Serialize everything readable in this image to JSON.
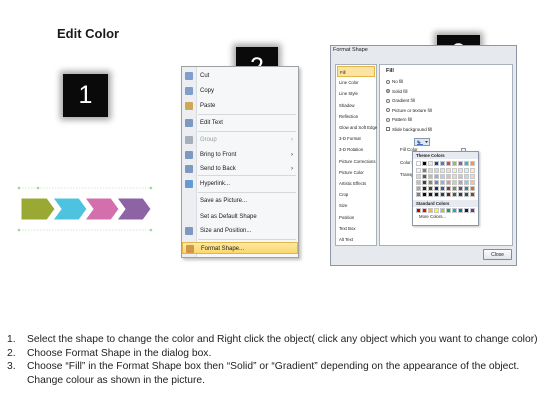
{
  "title": "Edit Color",
  "badges": [
    "1",
    "2",
    "3"
  ],
  "colors": {
    "arrow_green": "#9aa834",
    "arrow_cyan": "#4ec3df",
    "arrow_pink": "#d46fae",
    "arrow_purple": "#8e63a6",
    "highlight": "#fbd66b",
    "dialog_bg": "#e6e9ee"
  },
  "context_menu": {
    "items": [
      {
        "label": "Cut",
        "icon": "scissors-icon"
      },
      {
        "label": "Copy",
        "icon": "copy-icon"
      },
      {
        "label": "Paste",
        "icon": "paste-icon"
      },
      {
        "label": "Edit Text",
        "icon": "edit-text-icon"
      },
      {
        "label": "Group",
        "icon": "group-icon",
        "arrow": "›"
      },
      {
        "label": "Bring to Front",
        "icon": "bring-front-icon",
        "arrow": "›"
      },
      {
        "label": "Send to Back",
        "icon": "send-back-icon",
        "arrow": "›"
      },
      {
        "label": "Hyperlink...",
        "icon": "hyperlink-icon"
      },
      {
        "label": "Save as Picture..."
      },
      {
        "label": "Set as Default Shape"
      },
      {
        "label": "Size and Position...",
        "icon": "size-icon"
      },
      {
        "label": "Format Shape...",
        "icon": "format-shape-icon"
      }
    ]
  },
  "format_dialog": {
    "title": "Format Shape",
    "categories": [
      "Fill",
      "Line Color",
      "Line Style",
      "Shadow",
      "Reflection",
      "Glow and Soft Edges",
      "3-D Format",
      "3-D Rotation",
      "Picture Corrections",
      "Picture Color",
      "Artistic Effects",
      "Crop",
      "Size",
      "Position",
      "Text Box",
      "Alt Text"
    ],
    "panel": {
      "heading": "Fill",
      "options": [
        "No fill",
        "Solid fill",
        "Gradient fill",
        "Picture or texture fill",
        "Pattern fill",
        "Slide background fill"
      ],
      "fill_color_label": "Fill Color",
      "color_label": "Color:",
      "transparency_label": "Transpa"
    },
    "picker": {
      "theme_colors_label": "Theme Colors",
      "standard_colors_label": "Standard Colors",
      "more_colors_label": "More Colors..."
    },
    "close_label": "Close"
  },
  "steps": [
    {
      "num": "1.",
      "text": "Select the shape to change the color and Right click the object( click any object which you want to change color)"
    },
    {
      "num": "2.",
      "text": "Choose Format Shape in the dialog box."
    },
    {
      "num": "3.",
      "text": "Choose “Fill” in the Format Shape box then “Solid” or “Gradient” depending on the appearance of the object. Change colour as shown in the picture."
    }
  ]
}
